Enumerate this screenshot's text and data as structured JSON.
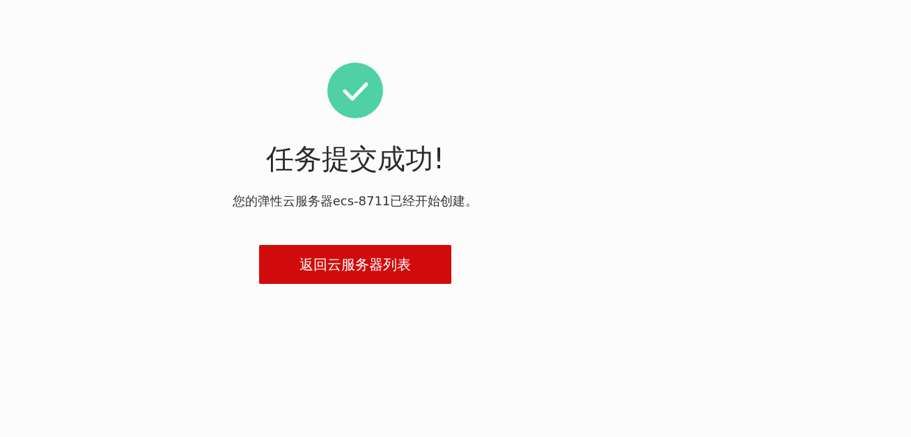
{
  "result": {
    "succeeded": true,
    "title": "任务提交成功!",
    "message": "您的弹性云服务器ecs-8711已经开始创建。"
  },
  "button": {
    "label": "返回云服务器列表"
  }
}
